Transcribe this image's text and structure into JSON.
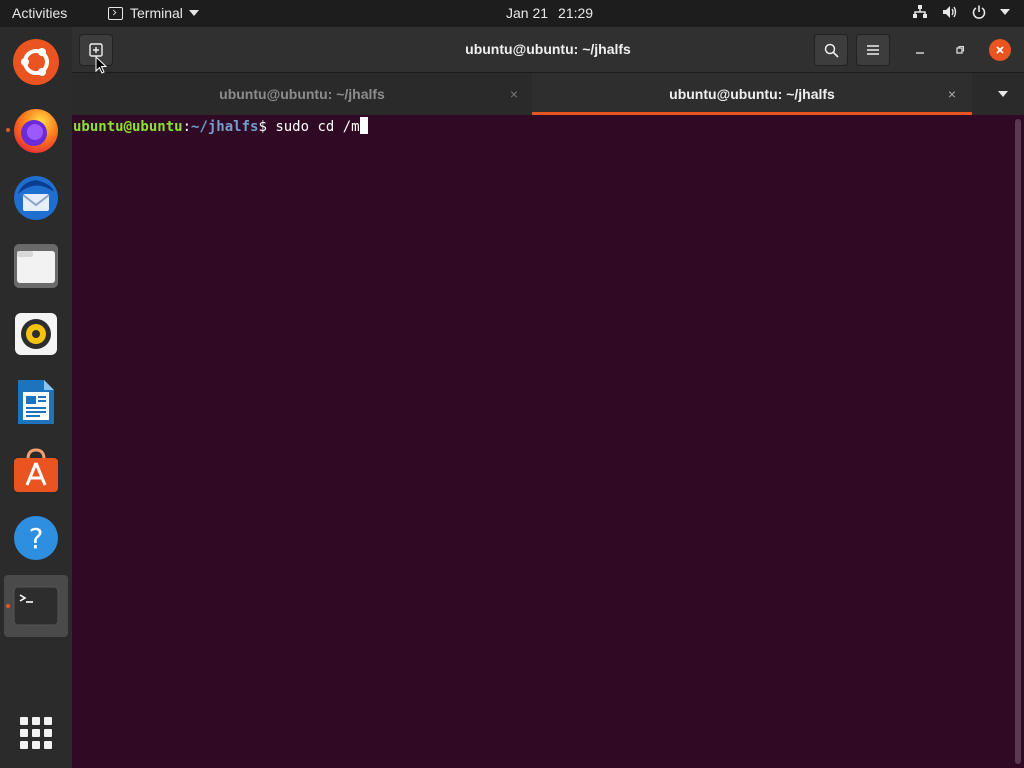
{
  "topbar": {
    "activities": "Activities",
    "app_name": "Terminal",
    "date": "Jan 21",
    "time": "21:29",
    "tray_icons": [
      "network-icon",
      "volume-icon",
      "power-icon",
      "chevron-down-icon"
    ]
  },
  "dock": {
    "items": [
      {
        "name": "ubuntu-logo",
        "running": false
      },
      {
        "name": "firefox",
        "running": true
      },
      {
        "name": "thunderbird",
        "running": false
      },
      {
        "name": "files",
        "running": false
      },
      {
        "name": "rhythmbox",
        "running": false
      },
      {
        "name": "libreoffice-writer",
        "running": false
      },
      {
        "name": "ubuntu-software",
        "running": false
      },
      {
        "name": "help",
        "running": false
      },
      {
        "name": "terminal",
        "running": true,
        "active": true
      }
    ],
    "show_apps": "show-applications-icon"
  },
  "window": {
    "title": "ubuntu@ubuntu: ~/jhalfs",
    "accent": "#e95420"
  },
  "tabs": [
    {
      "label": "ubuntu@ubuntu: ~/jhalfs",
      "active": false,
      "close": "×"
    },
    {
      "label": "ubuntu@ubuntu: ~/jhalfs",
      "active": true,
      "close": "×"
    }
  ],
  "terminal": {
    "user_host": "ubuntu@ubuntu",
    "sep": ":",
    "path": "~/jhalfs",
    "prompt_char": "$ ",
    "command": "sudo cd /m",
    "background": "#300a24"
  }
}
